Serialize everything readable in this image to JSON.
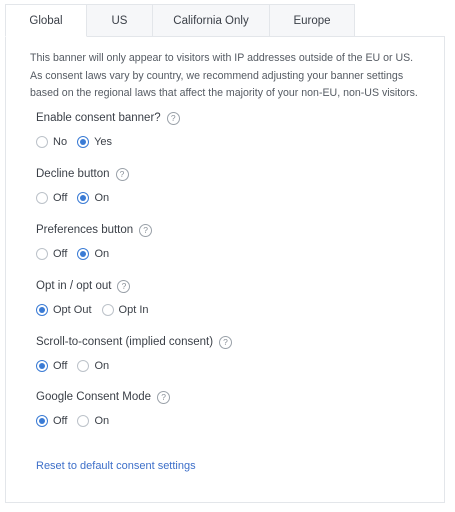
{
  "tabs": [
    "Global",
    "US",
    "California Only",
    "Europe"
  ],
  "description": "This banner will only appear to visitors with IP addresses outside of the EU or US. As consent laws vary by country, we recommend adjusting your banner settings based on the regional laws that affect the majority of your non-EU, non-US visitors.",
  "help_glyph": "?",
  "settings": [
    {
      "label": "Enable consent banner?",
      "options": [
        "No",
        "Yes"
      ],
      "selected": "Yes"
    },
    {
      "label": "Decline button",
      "options": [
        "Off",
        "On"
      ],
      "selected": "On"
    },
    {
      "label": "Preferences button",
      "options": [
        "Off",
        "On"
      ],
      "selected": "On"
    },
    {
      "label": "Opt in / opt out",
      "options": [
        "Opt Out",
        "Opt In"
      ],
      "selected": "Opt Out"
    },
    {
      "label": "Scroll-to-consent (implied consent)",
      "options": [
        "Off",
        "On"
      ],
      "selected": "Off"
    },
    {
      "label": "Google Consent Mode",
      "options": [
        "Off",
        "On"
      ],
      "selected": "Off"
    }
  ],
  "reset_link": "Reset to default consent settings",
  "colors": {
    "accent": "#3a7bd5",
    "link": "#3d6fc9",
    "border": "#e3e6ea"
  }
}
